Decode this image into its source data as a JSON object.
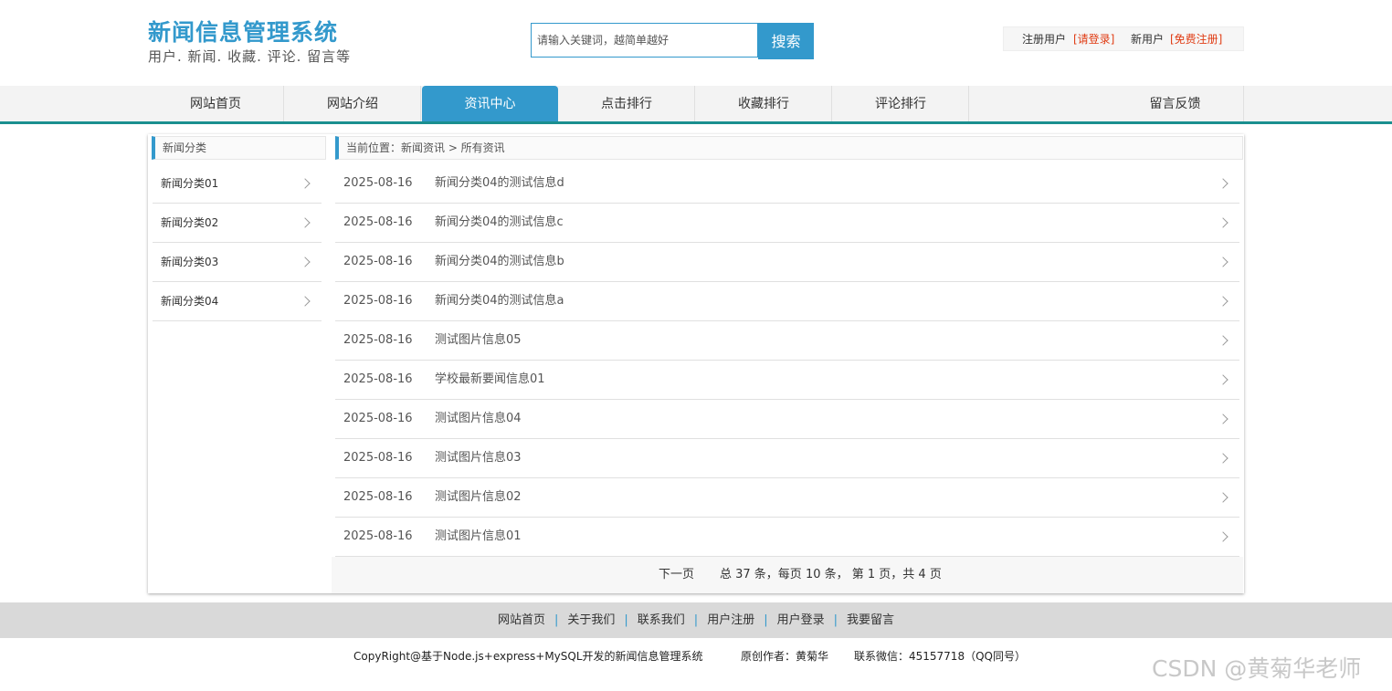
{
  "header": {
    "site_title": "新闻信息管理系统",
    "site_subtitle": "用户. 新闻. 收藏. 评论. 留言等",
    "search_placeholder": "请输入关键词，越简单越好",
    "search_button": "搜索",
    "user": {
      "registered_label": "注册用户",
      "login_link": "[请登录]",
      "new_user_label": "新用户",
      "register_link": "[免费注册]"
    }
  },
  "nav": {
    "items": [
      {
        "label": "网站首页"
      },
      {
        "label": "网站介绍"
      },
      {
        "label": "资讯中心",
        "active": true
      },
      {
        "label": "点击排行"
      },
      {
        "label": "收藏排行"
      },
      {
        "label": "评论排行"
      },
      {
        "label": "留言反馈"
      }
    ]
  },
  "sidebar": {
    "title": "新闻分类",
    "items": [
      {
        "label": "新闻分类01"
      },
      {
        "label": "新闻分类02"
      },
      {
        "label": "新闻分类03"
      },
      {
        "label": "新闻分类04"
      }
    ]
  },
  "main": {
    "breadcrumb": "当前位置：新闻资讯 > 所有资讯",
    "news": [
      {
        "date": "2025-08-16",
        "title": "新闻分类04的测试信息d"
      },
      {
        "date": "2025-08-16",
        "title": "新闻分类04的测试信息c"
      },
      {
        "date": "2025-08-16",
        "title": "新闻分类04的测试信息b"
      },
      {
        "date": "2025-08-16",
        "title": "新闻分类04的测试信息a"
      },
      {
        "date": "2025-08-16",
        "title": "测试图片信息05"
      },
      {
        "date": "2025-08-16",
        "title": "学校最新要闻信息01"
      },
      {
        "date": "2025-08-16",
        "title": "测试图片信息04"
      },
      {
        "date": "2025-08-16",
        "title": "测试图片信息03"
      },
      {
        "date": "2025-08-16",
        "title": "测试图片信息02"
      },
      {
        "date": "2025-08-16",
        "title": "测试图片信息01"
      }
    ],
    "pager": {
      "next": "下一页",
      "summary": "总 37 条，每页 10 条， 第 1 页，共 4 页"
    }
  },
  "footer": {
    "links": [
      "网站首页",
      "关于我们",
      "联系我们",
      "用户注册",
      "用户登录",
      "我要留言"
    ],
    "separator": "|",
    "copyright": "CopyRight@基于Node.js+express+MySQL开发的新闻信息管理系统",
    "author": "原创作者：黄菊华",
    "contact": "联系微信：45157718（QQ同号）"
  },
  "watermark": "CSDN @黄菊华老师",
  "colors": {
    "accent": "#3399cc",
    "nav_border": "#1a8f8f",
    "link_red": "#e03c14"
  }
}
